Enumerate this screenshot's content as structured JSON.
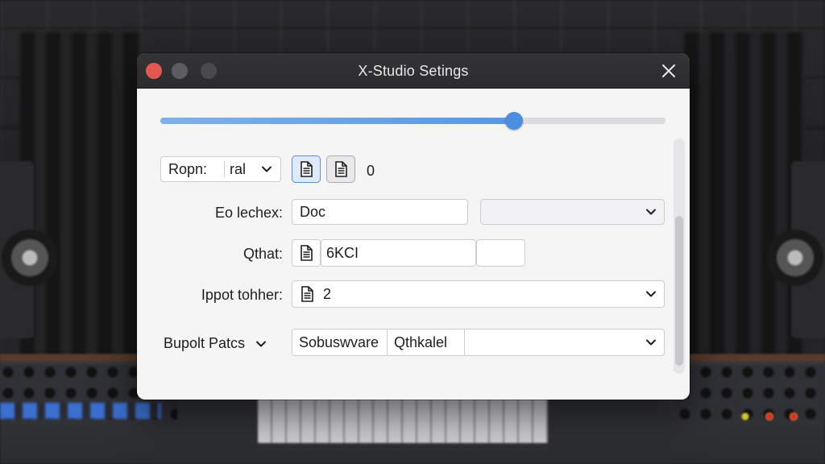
{
  "window": {
    "title": "X-Studio Setings"
  },
  "slider": {
    "value_fraction": 0.7
  },
  "row_ropm": {
    "label": "Ropn:",
    "value": "ral",
    "number": "0"
  },
  "row_eo": {
    "label": "Eo lechex:",
    "input_value": "Doc",
    "select_value": ""
  },
  "row_qthat": {
    "label": "Qthat:",
    "input_value": "6KCI",
    "extra_value": ""
  },
  "row_ippot": {
    "label": "Ippot tohher:",
    "value": "2"
  },
  "row_bupolt": {
    "label": "Bupolt Patcs",
    "seg1": "Sobuswvare",
    "seg2": "Qthkalel"
  },
  "icons": {
    "document": "document-icon",
    "chevron": "chevron-down-icon",
    "close": "close-icon"
  },
  "colors": {
    "accent": "#4b8ee0",
    "titlebar": "#2c2c2e",
    "close_red": "#e05a52"
  }
}
